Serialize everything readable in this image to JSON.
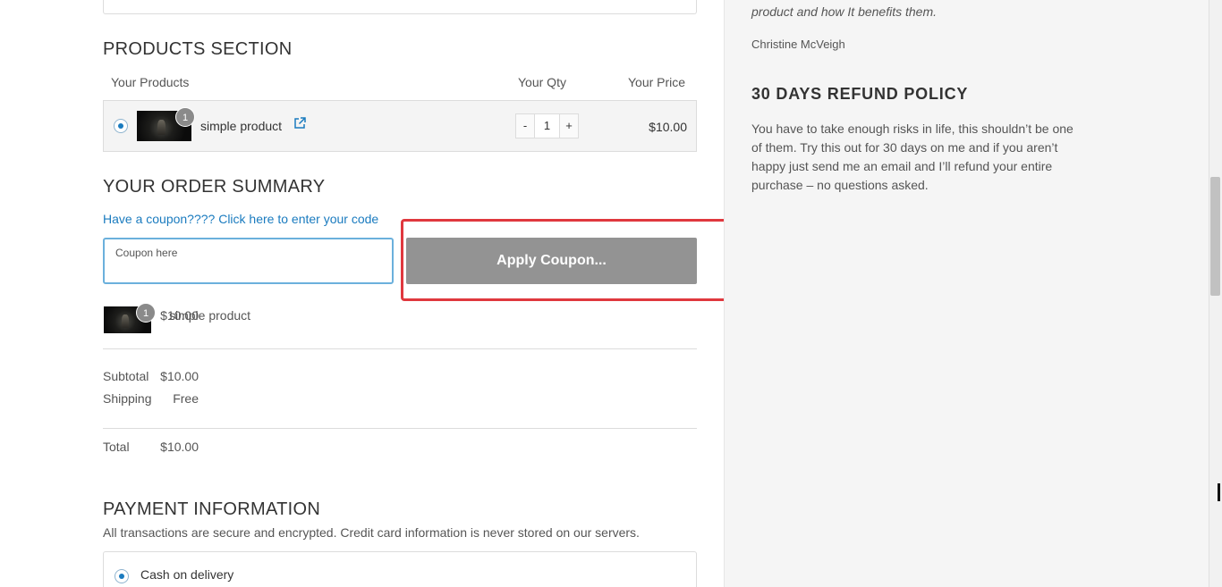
{
  "products_section": {
    "title": "PRODUCTS SECTION",
    "col_products": "Your Products",
    "col_qty": "Your Qty",
    "col_price": "Your Price",
    "product": {
      "name": "simple product",
      "badge": "1",
      "qty": "1",
      "minus": "-",
      "plus": "+",
      "price": "$10.00",
      "link_icon": "external-link-icon"
    }
  },
  "order_summary": {
    "title": "YOUR ORDER SUMMARY",
    "coupon_link": "Have a coupon???? Click here to enter your code",
    "coupon_label": "Coupon here",
    "coupon_value": "",
    "apply_label": "Apply Coupon...",
    "item": {
      "name": "simple product",
      "badge": "1",
      "price": "$10.00"
    },
    "subtotal_label": "Subtotal",
    "subtotal_value": "$10.00",
    "shipping_label": "Shipping",
    "shipping_value": "Free",
    "total_label": "Total",
    "total_value": "$10.00"
  },
  "payment": {
    "title": "PAYMENT INFORMATION",
    "description": "All transactions are secure and encrypted. Credit card information is never stored on our servers.",
    "option": "Cash on delivery"
  },
  "sidebar": {
    "quote_tail": "product and how It benefits them.",
    "author": "Christine McVeigh",
    "refund_title": "30 DAYS REFUND POLICY",
    "refund_text": "You have to take enough risks in life, this shouldn’t be one of them. Try this out for 30 days on me and if you aren’t happy just send me an email and I’ll refund your entire purchase – no questions asked."
  },
  "colors": {
    "accent": "#1a7bbf",
    "button_bg": "#939393",
    "highlight": "#e0383e"
  }
}
